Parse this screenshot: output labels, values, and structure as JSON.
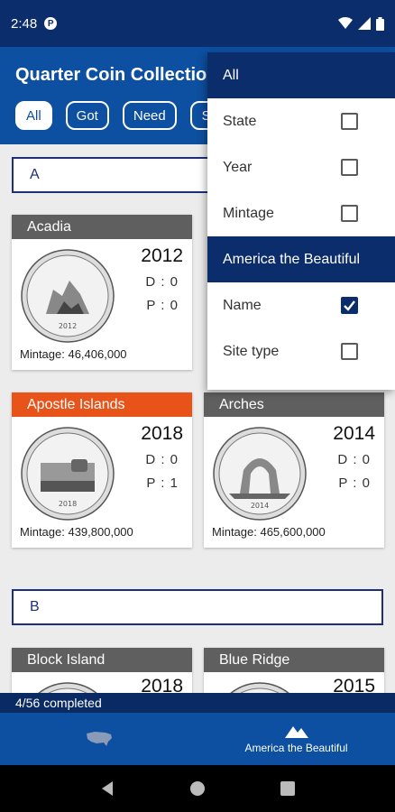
{
  "status_bar": {
    "time": "2:48",
    "notification_badge": "P"
  },
  "app": {
    "title": "Quarter Coin Collection"
  },
  "filters": [
    {
      "label": "All",
      "active": true
    },
    {
      "label": "Got",
      "active": false
    },
    {
      "label": "Need",
      "active": false
    },
    {
      "label": "St",
      "active": false
    }
  ],
  "sections": [
    {
      "label": "A"
    },
    {
      "label": "B"
    }
  ],
  "coins": [
    {
      "name": "Acadia",
      "year": "2012",
      "d": "D : 0",
      "p": "P : 0",
      "mintage": "Mintage: 46,406,000",
      "header_color": "grey",
      "coin_year_text": "2012"
    },
    {
      "name": "Apostle Islands",
      "year": "2018",
      "d": "D : 0",
      "p": "P : 1",
      "mintage": "Mintage: 439,800,000",
      "header_color": "orange",
      "coin_year_text": "2018"
    },
    {
      "name": "Arches",
      "year": "2014",
      "d": "D : 0",
      "p": "P : 0",
      "mintage": "Mintage: 465,600,000",
      "header_color": "grey",
      "coin_year_text": "2014"
    },
    {
      "name": "Block Island",
      "year": "2018",
      "header_color": "grey"
    },
    {
      "name": "Blue Ridge",
      "year": "2015",
      "header_color": "grey"
    }
  ],
  "sort_menu": {
    "header": "All",
    "items": [
      {
        "label": "State",
        "checked": false
      },
      {
        "label": "Year",
        "checked": false
      },
      {
        "label": "Mintage",
        "checked": false
      }
    ],
    "section": "America the Beautiful",
    "items2": [
      {
        "label": "Name",
        "checked": true
      },
      {
        "label": "Site type",
        "checked": false
      }
    ]
  },
  "progress": {
    "text": "4/56 completed",
    "completed": 4,
    "total": 56
  },
  "bottom_nav": [
    {
      "label": "",
      "icon": "us-map-icon"
    },
    {
      "label": "America the Beautiful",
      "icon": "mountains-icon"
    }
  ],
  "colors": {
    "primary": "#0d4fa0",
    "dark": "#0c2d6b",
    "orange": "#e8531a",
    "grey": "#5f5f5f"
  }
}
